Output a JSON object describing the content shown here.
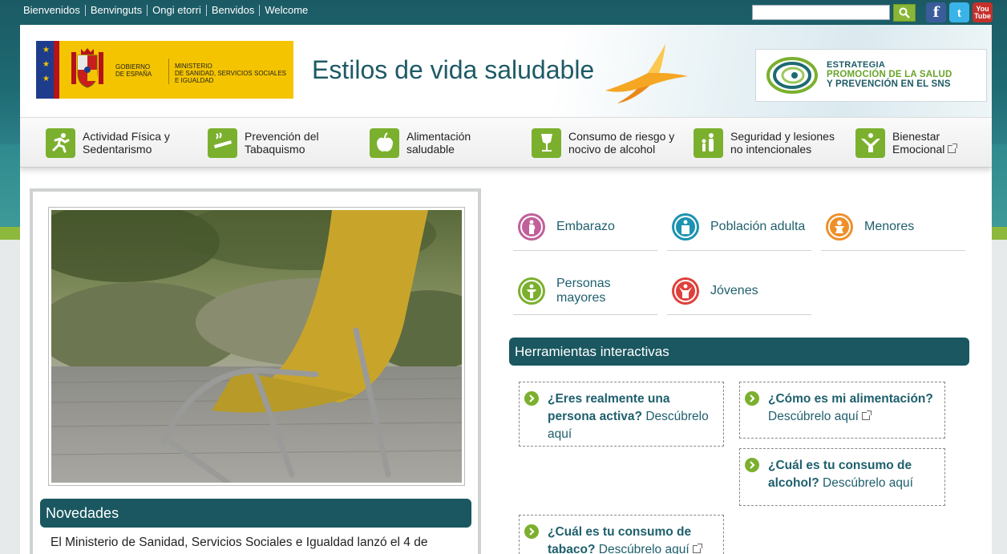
{
  "top": {
    "languages": [
      "Bienvenidos",
      "Benvinguts",
      "Ongi etorri",
      "Benvidos",
      "Welcome"
    ],
    "search_placeholder": "",
    "social": [
      "facebook-icon",
      "twitter-icon",
      "youtube-icon"
    ],
    "twitter_glyph": "t",
    "facebook_glyph": "f",
    "youtube_top": "You",
    "youtube_bottom": "Tube"
  },
  "header": {
    "gov_line1": "GOBIERNO",
    "gov_line2": "DE ESPAÑA",
    "ministry_line1": "MINISTERIO",
    "ministry_line2": "DE SANIDAD, SERVICIOS SOCIALES",
    "ministry_line3": "E IGUALDAD",
    "site_title": "Estilos de vida saludable",
    "strategy_line1": "ESTRATEGIA",
    "strategy_line2": "PROMOCIÓN DE LA SALUD",
    "strategy_line3": "Y PREVENCIÓN EN EL SNS"
  },
  "nav": [
    {
      "line1": "Actividad Física y",
      "line2": "Sedentarismo",
      "icon": "running-icon"
    },
    {
      "line1": "Prevención del",
      "line2": "Tabaquismo",
      "icon": "cigarette-icon"
    },
    {
      "line1": "Alimentación",
      "line2": "saludable",
      "icon": "apple-icon"
    },
    {
      "line1": "Consumo de riesgo y",
      "line2": "nocivo de alcohol",
      "icon": "glass-icon"
    },
    {
      "line1": "Seguridad y lesiones",
      "line2": "no intencionales",
      "icon": "family-icon"
    },
    {
      "line1": "Bienestar",
      "line2": "Emocional",
      "icon": "heart-person-icon"
    }
  ],
  "groups": [
    {
      "label": "Embarazo",
      "color": "#c0609a"
    },
    {
      "label": "Población adulta",
      "color": "#1c93b0"
    },
    {
      "label": "Menores",
      "color": "#ef8f2a"
    },
    {
      "label1": "Personas",
      "label2": "mayores",
      "color": "#7bb02e"
    },
    {
      "label": "Jóvenes",
      "color": "#e0403c"
    }
  ],
  "novedades": {
    "title": "Novedades",
    "text": "El Ministerio de Sanidad, Servicios Sociales e Igualdad lanzó el 4 de"
  },
  "tools": {
    "title": "Herramientas interactivas",
    "items": [
      {
        "q1": "¿Eres realmente una",
        "q2": "persona activa?",
        "link": "Descúbrelo",
        "link2": "aquí"
      },
      {
        "q1": "¿Cómo es mi alimentación?",
        "link": "Descúbrelo aquí"
      },
      {
        "q1": "¿Cuál es tu consumo de",
        "q2": "alcohol?",
        "link": "Descúbrelo aquí"
      },
      {
        "q1": "¿Cuál es tu consumo de",
        "q2": "tabaco?",
        "link": "Descúbrelo aquí"
      }
    ]
  },
  "colors": {
    "brand": "#1a5760",
    "green": "#7bb02e",
    "gov_yellow": "#f4c400"
  }
}
